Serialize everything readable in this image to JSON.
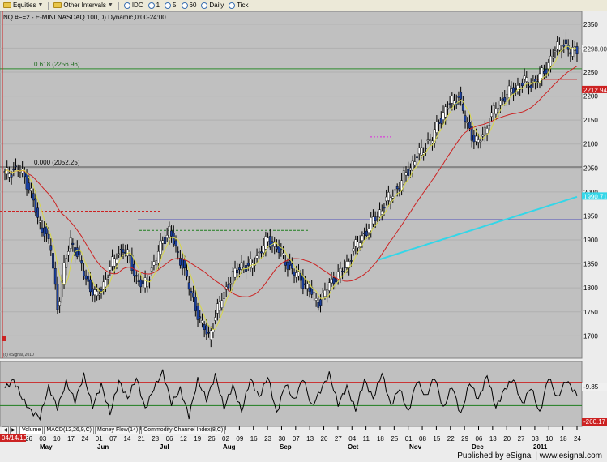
{
  "toolbar": {
    "equities": "Equities",
    "other_intervals": "Other Intervals",
    "intervals": [
      "IDC",
      "1",
      "5",
      "60",
      "Daily",
      "Tick"
    ]
  },
  "chart": {
    "title": "NQ #F=2 - E-MINI NASDAQ 100,D) Dynamic,0:00-24:00",
    "fib_618_label": "0.618 (2256.96)",
    "fib_000_label": "0.000 (2052.25)",
    "watermark": "(c) eSignal, 2010",
    "price_tags": {
      "current": "2298.00",
      "ma": "2212.94",
      "ma_long": "1990.71",
      "indicator_top": "-9.85",
      "indicator_bottom": "-260.17"
    },
    "start_date": "04/14/10",
    "month_labels": [
      "May",
      "Jun",
      "Jul",
      "Aug",
      "Sep",
      "Oct",
      "Nov",
      "Dec",
      "2011"
    ],
    "date_ticks": [
      "26",
      "03",
      "10",
      "17",
      "24",
      "01",
      "07",
      "14",
      "21",
      "28",
      "06",
      "12",
      "19",
      "26",
      "02",
      "09",
      "16",
      "23",
      "30",
      "07",
      "13",
      "20",
      "27",
      "04",
      "11",
      "18",
      "25",
      "01",
      "08",
      "15",
      "22",
      "29",
      "06",
      "13",
      "20",
      "27",
      "03",
      "10",
      "18",
      "24"
    ]
  },
  "tabs": [
    "Volume",
    "MACD(12,26,9,C)",
    "Money Flow(14)",
    "Commodity Channel Index(8,C)"
  ],
  "footer": {
    "text": "Published by eSignal | www.esignal.com"
  },
  "colors": {
    "chart_bg": "#c0c0c0",
    "up_candle": "#ffffff",
    "down_candle": "#1a3f9c",
    "fib_line": "#2e8b2e",
    "ma_short": "#d8d84a",
    "ma_mid": "#cc2222",
    "ma_long": "#33d6e8",
    "support": "#2a2ab8"
  },
  "chart_data": {
    "type": "candlestick",
    "price_ylim": [
      1660,
      2370
    ],
    "price_ticks": [
      1700,
      1750,
      1800,
      1850,
      1900,
      1950,
      2000,
      2050,
      2100,
      2150,
      2200,
      2250,
      2300,
      2350
    ],
    "cci_ylim": [
      -250,
      250
    ],
    "levels": {
      "fib_618": 2256.96,
      "fib_000": 2052.25,
      "support": 1942,
      "resistance_red": 1960,
      "green_dashed": 1920,
      "red_hline": 2235,
      "pink_dashed": 2115
    },
    "close_series": [
      [
        0,
        2035
      ],
      [
        3,
        2045
      ],
      [
        6,
        2050
      ],
      [
        9,
        2030
      ],
      [
        12,
        2000
      ],
      [
        15,
        1940
      ],
      [
        18,
        1920
      ],
      [
        21,
        1880
      ],
      [
        24,
        1760
      ],
      [
        27,
        1840
      ],
      [
        30,
        1900
      ],
      [
        33,
        1870
      ],
      [
        36,
        1830
      ],
      [
        39,
        1800
      ],
      [
        42,
        1780
      ],
      [
        45,
        1810
      ],
      [
        48,
        1840
      ],
      [
        51,
        1870
      ],
      [
        54,
        1880
      ],
      [
        57,
        1860
      ],
      [
        60,
        1820
      ],
      [
        63,
        1800
      ],
      [
        66,
        1830
      ],
      [
        69,
        1860
      ],
      [
        72,
        1900
      ],
      [
        75,
        1920
      ],
      [
        78,
        1880
      ],
      [
        81,
        1850
      ],
      [
        84,
        1800
      ],
      [
        87,
        1760
      ],
      [
        90,
        1720
      ],
      [
        93,
        1700
      ],
      [
        96,
        1740
      ],
      [
        99,
        1780
      ],
      [
        102,
        1810
      ],
      [
        105,
        1830
      ],
      [
        108,
        1850
      ],
      [
        111,
        1840
      ],
      [
        114,
        1860
      ],
      [
        117,
        1880
      ],
      [
        120,
        1900
      ],
      [
        123,
        1890
      ],
      [
        126,
        1870
      ],
      [
        129,
        1850
      ],
      [
        132,
        1830
      ],
      [
        135,
        1820
      ],
      [
        138,
        1800
      ],
      [
        141,
        1780
      ],
      [
        144,
        1770
      ],
      [
        147,
        1800
      ],
      [
        150,
        1820
      ],
      [
        153,
        1830
      ],
      [
        156,
        1850
      ],
      [
        159,
        1880
      ],
      [
        162,
        1900
      ],
      [
        165,
        1920
      ],
      [
        168,
        1940
      ],
      [
        171,
        1960
      ],
      [
        174,
        1980
      ],
      [
        177,
        2000
      ],
      [
        180,
        2010
      ],
      [
        183,
        2040
      ],
      [
        186,
        2060
      ],
      [
        189,
        2080
      ],
      [
        192,
        2100
      ],
      [
        195,
        2110
      ],
      [
        198,
        2150
      ],
      [
        201,
        2170
      ],
      [
        204,
        2190
      ],
      [
        207,
        2200
      ],
      [
        210,
        2150
      ],
      [
        213,
        2120
      ],
      [
        216,
        2100
      ],
      [
        219,
        2130
      ],
      [
        222,
        2160
      ],
      [
        225,
        2180
      ],
      [
        228,
        2200
      ],
      [
        231,
        2210
      ],
      [
        234,
        2220
      ],
      [
        237,
        2230
      ],
      [
        240,
        2225
      ],
      [
        243,
        2235
      ],
      [
        246,
        2250
      ],
      [
        249,
        2280
      ],
      [
        252,
        2300
      ],
      [
        255,
        2310
      ],
      [
        258,
        2290
      ],
      [
        261,
        2298
      ]
    ],
    "cci_series": [
      [
        0,
        50
      ],
      [
        4,
        120
      ],
      [
        8,
        -40
      ],
      [
        12,
        -150
      ],
      [
        16,
        -200
      ],
      [
        20,
        60
      ],
      [
        24,
        -120
      ],
      [
        28,
        100
      ],
      [
        32,
        -60
      ],
      [
        36,
        160
      ],
      [
        40,
        -110
      ],
      [
        44,
        80
      ],
      [
        48,
        -170
      ],
      [
        52,
        110
      ],
      [
        56,
        -40
      ],
      [
        60,
        140
      ],
      [
        64,
        -130
      ],
      [
        68,
        50
      ],
      [
        72,
        190
      ],
      [
        76,
        -80
      ],
      [
        80,
        40
      ],
      [
        84,
        -190
      ],
      [
        88,
        120
      ],
      [
        92,
        -50
      ],
      [
        96,
        160
      ],
      [
        100,
        -120
      ],
      [
        104,
        70
      ],
      [
        108,
        -150
      ],
      [
        112,
        130
      ],
      [
        116,
        -30
      ],
      [
        120,
        150
      ],
      [
        124,
        -170
      ],
      [
        128,
        90
      ],
      [
        132,
        -60
      ],
      [
        136,
        140
      ],
      [
        140,
        -110
      ],
      [
        144,
        30
      ],
      [
        148,
        170
      ],
      [
        152,
        -90
      ],
      [
        156,
        60
      ],
      [
        160,
        -140
      ],
      [
        164,
        120
      ],
      [
        168,
        -40
      ],
      [
        172,
        180
      ],
      [
        176,
        -100
      ],
      [
        180,
        50
      ],
      [
        184,
        -160
      ],
      [
        188,
        120
      ],
      [
        192,
        -30
      ],
      [
        196,
        150
      ],
      [
        200,
        -130
      ],
      [
        204,
        70
      ],
      [
        208,
        -180
      ],
      [
        212,
        100
      ],
      [
        216,
        -50
      ],
      [
        220,
        160
      ],
      [
        224,
        -120
      ],
      [
        228,
        40
      ],
      [
        232,
        130
      ],
      [
        236,
        -90
      ],
      [
        240,
        60
      ],
      [
        244,
        -170
      ],
      [
        248,
        150
      ],
      [
        252,
        -40
      ],
      [
        256,
        120
      ],
      [
        261,
        -10
      ]
    ]
  }
}
